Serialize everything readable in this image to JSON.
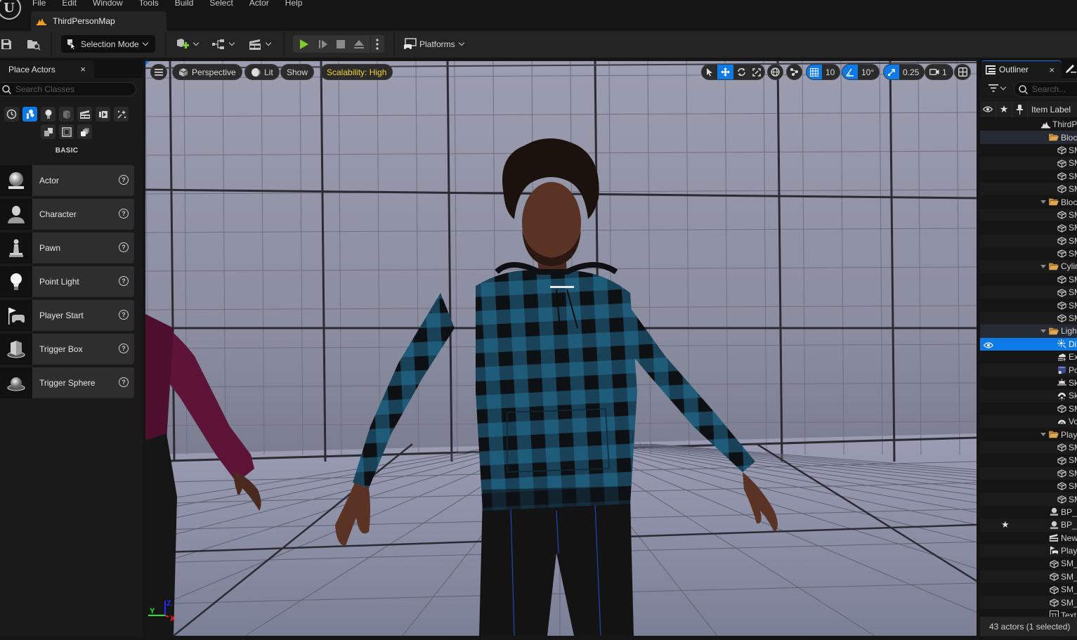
{
  "app": {
    "menus": [
      "File",
      "Edit",
      "Window",
      "Tools",
      "Build",
      "Select",
      "Actor",
      "Help"
    ],
    "map_tab": "ThirdPersonMap"
  },
  "toolbar": {
    "selection_mode": "Selection Mode",
    "platforms": "Platforms",
    "play_color": "#7fcc2a"
  },
  "place_actors": {
    "tab_label": "Place Actors",
    "close": "×",
    "search_placeholder": "Search Classes",
    "categories": [
      {
        "icon": "clock-icon",
        "name": "recently-placed"
      },
      {
        "icon": "basic-shapes-icon",
        "name": "basic",
        "active": true
      },
      {
        "icon": "lightbulb-icon",
        "name": "lights"
      },
      {
        "icon": "cube-icon",
        "name": "shapes"
      },
      {
        "icon": "clapperboard-icon",
        "name": "cinematic"
      },
      {
        "icon": "media-icon",
        "name": "visual-effects"
      },
      {
        "icon": "sparkles-icon",
        "name": "effects"
      },
      {
        "icon": "volumes-icon",
        "name": "volumes"
      },
      {
        "icon": "frame-icon",
        "name": "geometry"
      },
      {
        "icon": "stack-icon",
        "name": "all-classes"
      }
    ],
    "section_label": "BASIC",
    "items": [
      {
        "label": "Actor",
        "icon": "actor-sphere-icon"
      },
      {
        "label": "Character",
        "icon": "character-icon"
      },
      {
        "label": "Pawn",
        "icon": "pawn-icon"
      },
      {
        "label": "Point Light",
        "icon": "point-light-icon"
      },
      {
        "label": "Player Start",
        "icon": "player-start-icon"
      },
      {
        "label": "Trigger Box",
        "icon": "trigger-box-icon"
      },
      {
        "label": "Trigger Sphere",
        "icon": "trigger-sphere-icon"
      }
    ],
    "help_glyph": "?"
  },
  "viewport": {
    "view_mode": "Perspective",
    "lighting": "Lit",
    "show": "Show",
    "scalability": "Scalability: High",
    "scalability_color": "#f2d22e",
    "grid_snap": "10",
    "rotation_snap": "10°",
    "scale_snap": "0.25",
    "camera_speed": "1",
    "axis_labels": {
      "x": "X",
      "y": "Y",
      "z": "Z"
    }
  },
  "outliner": {
    "tab_label": "Outliner",
    "close": "×",
    "search_placeholder": "Search...",
    "column_label": "Item Label",
    "rows": [
      {
        "label": "ThirdPersonMap",
        "type": "map",
        "depth": 0
      },
      {
        "label": "BlockoutArea",
        "type": "folder",
        "depth": 1,
        "highlight": true
      },
      {
        "label": "SM_Cube",
        "type": "mesh",
        "depth": 2
      },
      {
        "label": "SM_Cube",
        "type": "mesh",
        "depth": 2
      },
      {
        "label": "SM_Cube",
        "type": "mesh",
        "depth": 2
      },
      {
        "label": "SM_Cube",
        "type": "mesh",
        "depth": 2
      },
      {
        "label": "Blocks",
        "type": "folder",
        "depth": 1,
        "expanded": true
      },
      {
        "label": "SM_Cube",
        "type": "mesh",
        "depth": 2
      },
      {
        "label": "SM_Cube",
        "type": "mesh",
        "depth": 2
      },
      {
        "label": "SM_Cube",
        "type": "mesh",
        "depth": 2
      },
      {
        "label": "SM_Cube",
        "type": "mesh",
        "depth": 2
      },
      {
        "label": "Cylinders",
        "type": "folder",
        "depth": 1,
        "expanded": true
      },
      {
        "label": "SM_Cylinder",
        "type": "mesh",
        "depth": 2
      },
      {
        "label": "SM_Cylinder",
        "type": "mesh",
        "depth": 2
      },
      {
        "label": "SM_Cylinder",
        "type": "mesh",
        "depth": 2
      },
      {
        "label": "SM_Cylinder",
        "type": "mesh",
        "depth": 2
      },
      {
        "label": "Lighting",
        "type": "folder",
        "depth": 1,
        "expanded": true,
        "highlight": true
      },
      {
        "label": "DirectionalLight",
        "type": "dirlight",
        "depth": 2,
        "selected": true
      },
      {
        "label": "ExponentialHeightFog",
        "type": "fog",
        "depth": 2
      },
      {
        "label": "PostProcessVolume",
        "type": "volume",
        "depth": 2
      },
      {
        "label": "SkyAtmosphere",
        "type": "sky",
        "depth": 2
      },
      {
        "label": "SkyLight",
        "type": "skylight",
        "depth": 2
      },
      {
        "label": "SM_SkySphere",
        "type": "mesh",
        "depth": 2
      },
      {
        "label": "VolumetricCloud",
        "type": "cloud",
        "depth": 2
      },
      {
        "label": "PlayArea",
        "type": "folder",
        "depth": 1,
        "expanded": true
      },
      {
        "label": "SM_Cube",
        "type": "mesh",
        "depth": 2
      },
      {
        "label": "SM_Cube",
        "type": "mesh",
        "depth": 2
      },
      {
        "label": "SM_Cube",
        "type": "mesh",
        "depth": 2
      },
      {
        "label": "SM_Cube",
        "type": "mesh",
        "depth": 2
      },
      {
        "label": "SM_Cube",
        "type": "mesh",
        "depth": 2
      },
      {
        "label": "BP_",
        "type": "blueprint",
        "depth": 0
      },
      {
        "label": "BP_",
        "type": "blueprint",
        "depth": 0,
        "starred": true
      },
      {
        "label": "NewLevelSequence",
        "type": "sequence",
        "depth": 0
      },
      {
        "label": "PlayerStart",
        "type": "playerstart",
        "depth": 0
      },
      {
        "label": "SM_",
        "type": "mesh",
        "depth": 0
      },
      {
        "label": "SM_",
        "type": "mesh",
        "depth": 0
      },
      {
        "label": "SM_",
        "type": "mesh",
        "depth": 0
      },
      {
        "label": "SM_",
        "type": "mesh",
        "depth": 0
      },
      {
        "label": "TextRenderActor",
        "type": "text",
        "depth": 0
      }
    ],
    "status": "43 actors (1 selected)"
  },
  "colors": {
    "accent": "#0e7ae8",
    "folder": "#c98d3a",
    "panel": "#1a1a1a"
  }
}
